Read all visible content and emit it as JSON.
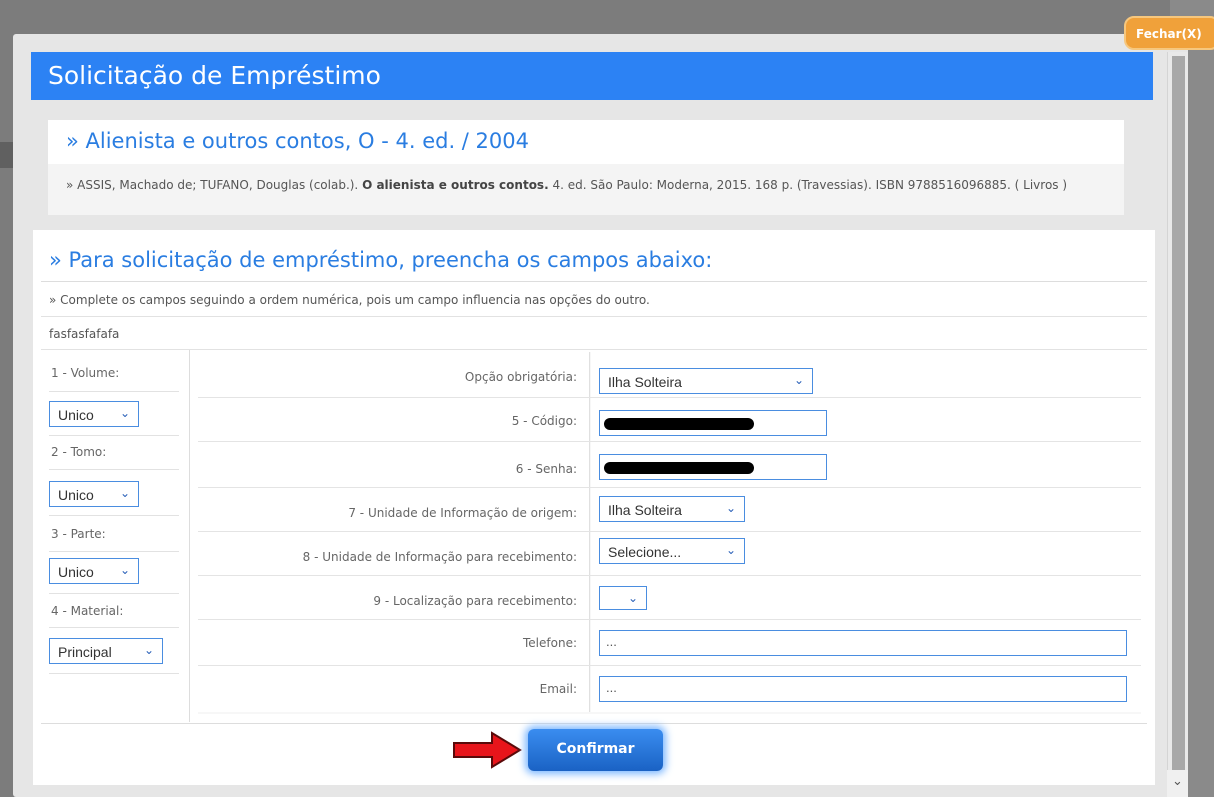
{
  "close_label": "Fechar(X)",
  "dialog_title": "Solicitação de Empréstimo",
  "book": {
    "title": "» Alienista e outros contos, O - 4. ed. / 2004",
    "desc_prefix": "» ASSIS, Machado de; TUFANO, Douglas (colab.).",
    "desc_bold": "O alienista e outros contos.",
    "desc_suffix": "4. ed. São Paulo: Moderna, 2015. 168 p. (Travessias). ISBN 9788516096885. ( Livros )"
  },
  "form": {
    "heading": "» Para solicitação de empréstimo, preencha os campos abaixo:",
    "note": "» Complete os campos seguindo a ordem numérica, pois um campo influencia nas opções do outro.",
    "extra": "fasfasfafafa"
  },
  "left": {
    "volume_label": "1 - Volume:",
    "volume_value": "Unico",
    "tomo_label": "2 - Tomo:",
    "tomo_value": "Unico",
    "parte_label": "3 - Parte:",
    "parte_value": "Unico",
    "material_label": "4 - Material:",
    "material_value": "Principal"
  },
  "fields": {
    "opcao_label": "Opção obrigatória:",
    "opcao_value": "Ilha Solteira",
    "codigo_label": "5 - Código:",
    "senha_label": "6 - Senha:",
    "origem_label": "7 - Unidade de Informação de origem:",
    "origem_value": "Ilha Solteira",
    "recebimento_label": "8 - Unidade de Informação para recebimento:",
    "recebimento_value": "Selecione...",
    "localizacao_label": "9 - Localização para recebimento:",
    "localizacao_value": "",
    "telefone_label": "Telefone:",
    "telefone_value": "...",
    "email_label": "Email:",
    "email_value": "..."
  },
  "confirm_label": "Confirmar",
  "colors": {
    "title_bar": "#2c82f4",
    "link_blue": "#2a7de1",
    "close_orange": "#f0a13a",
    "arrow_red": "#e8151b"
  }
}
